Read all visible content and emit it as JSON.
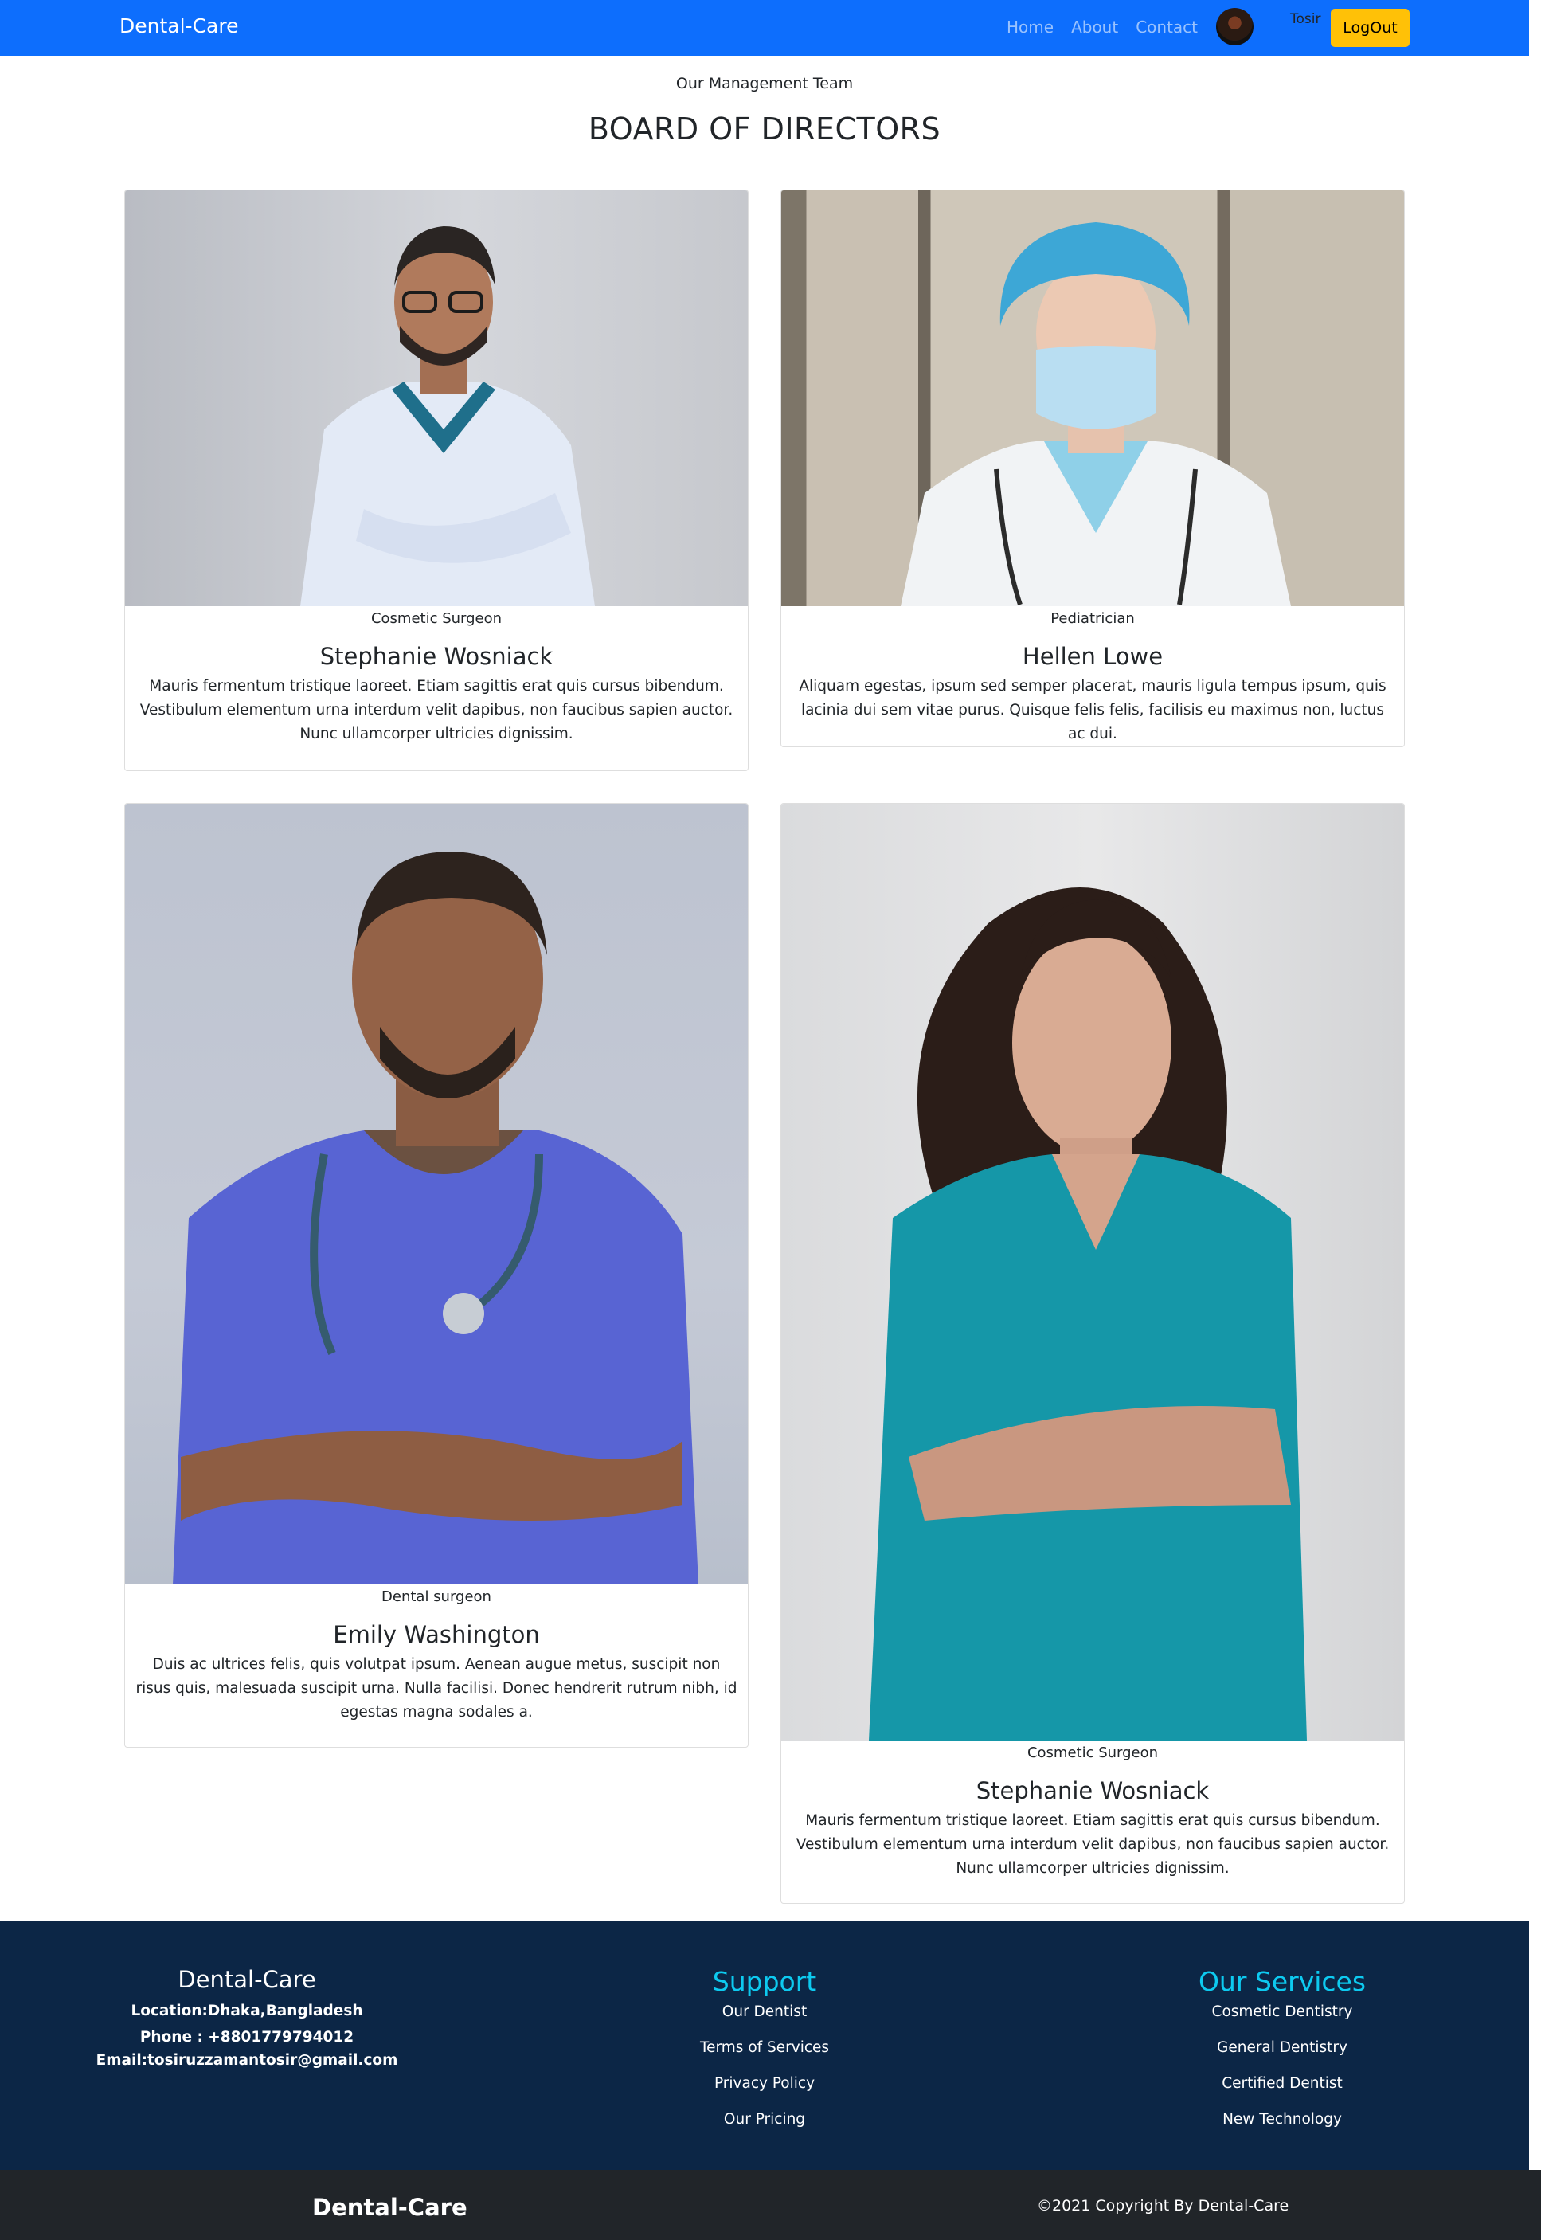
{
  "navbar": {
    "brand": "Dental-Care",
    "links": [
      "Home",
      "About",
      "Contact"
    ],
    "user_name": "Tosir",
    "logout_label": "LogOut",
    "color": "#0d6efd"
  },
  "section": {
    "kicker": "Our Management Team",
    "title": "BOARD OF DIRECTORS"
  },
  "cards": [
    {
      "role": "Cosmetic Surgeon",
      "name": "Stephanie Wosniack",
      "text": "Mauris fermentum tristique laoreet. Etiam sagittis erat quis cursus bibendum. Vestibulum elementum urna interdum velit dapibus, non faucibus sapien auctor. Nunc ullamcorper ultricies dignissim."
    },
    {
      "role": "Pediatrician",
      "name": "Hellen Lowe",
      "text": "Aliquam egestas, ipsum sed semper placerat, mauris ligula tempus ipsum, quis lacinia dui sem vitae purus. Quisque felis felis, facilisis eu maximus non, luctus ac dui."
    },
    {
      "role": "Dental surgeon",
      "name": "Emily Washington",
      "text": "Duis ac ultrices felis, quis volutpat ipsum. Aenean augue metus, suscipit non risus quis, malesuada suscipit urna. Nulla facilisi. Donec hendrerit rutrum nibh, id egestas magna sodales a."
    },
    {
      "role": "Cosmetic Surgeon",
      "name": "Stephanie Wosniack",
      "text": "Mauris fermentum tristique laoreet. Etiam sagittis erat quis cursus bibendum. Vestibulum elementum urna interdum velit dapibus, non faucibus sapien auctor. Nunc ullamcorper ultricies dignissim."
    }
  ],
  "footer": {
    "brand": "Dental-Care",
    "location": "Location:Dhaka,Bangladesh",
    "phone": "Phone : +8801779794012",
    "email": "Email:tosiruzzamantosir@gmail.com",
    "support_heading": "Support",
    "support_links": [
      "Our Dentist",
      "Terms of Services",
      "Privacy Policy",
      "Our Pricing"
    ],
    "services_heading": "Our Services",
    "services_links": [
      "Cosmetic Dentistry",
      "General Dentistry",
      "Certified Dentist",
      "New Technology"
    ],
    "bg_color": "#0c2646",
    "heading_color": "#0dcaf0"
  },
  "bottom_bar": {
    "brand": "Dental-Care",
    "copyright": "©2021 Copyright By Dental-Care"
  }
}
